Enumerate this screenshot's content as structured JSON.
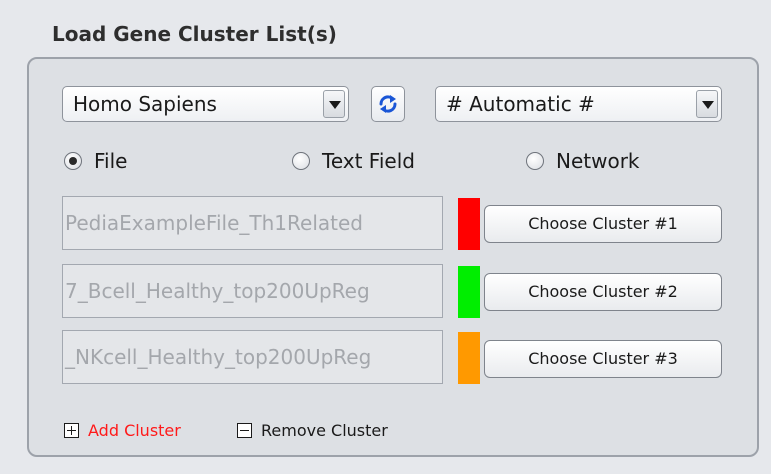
{
  "panel": {
    "title": "Load Gene Cluster List(s)"
  },
  "species_select": {
    "value": "Homo Sapiens",
    "arrow_icon": "chevron-down-icon"
  },
  "refresh": {
    "icon": "refresh-icon",
    "color": "#1a56d6"
  },
  "id_type_select": {
    "value": "# Automatic #",
    "arrow_icon": "chevron-down-icon"
  },
  "source": {
    "selected": "File",
    "options": [
      {
        "label": "File",
        "checked": true
      },
      {
        "label": "Text Field",
        "checked": false
      },
      {
        "label": "Network",
        "checked": false
      }
    ]
  },
  "clusters": [
    {
      "file": "PediaExampleFile_Th1Related",
      "color": "#ff0000",
      "button_label": "Choose Cluster #1"
    },
    {
      "file": "7_Bcell_Healthy_top200UpReg",
      "color": "#00ee00",
      "button_label": "Choose Cluster #2"
    },
    {
      "file": "_NKcell_Healthy_top200UpReg",
      "color": "#ff9900",
      "button_label": "Choose Cluster #3"
    }
  ],
  "actions": {
    "add_label": "Add Cluster",
    "add_icon": "plus-square-icon",
    "add_color": "#ff1a1a",
    "remove_label": "Remove Cluster",
    "remove_icon": "minus-square-icon",
    "remove_color": "#1a1a1a"
  }
}
